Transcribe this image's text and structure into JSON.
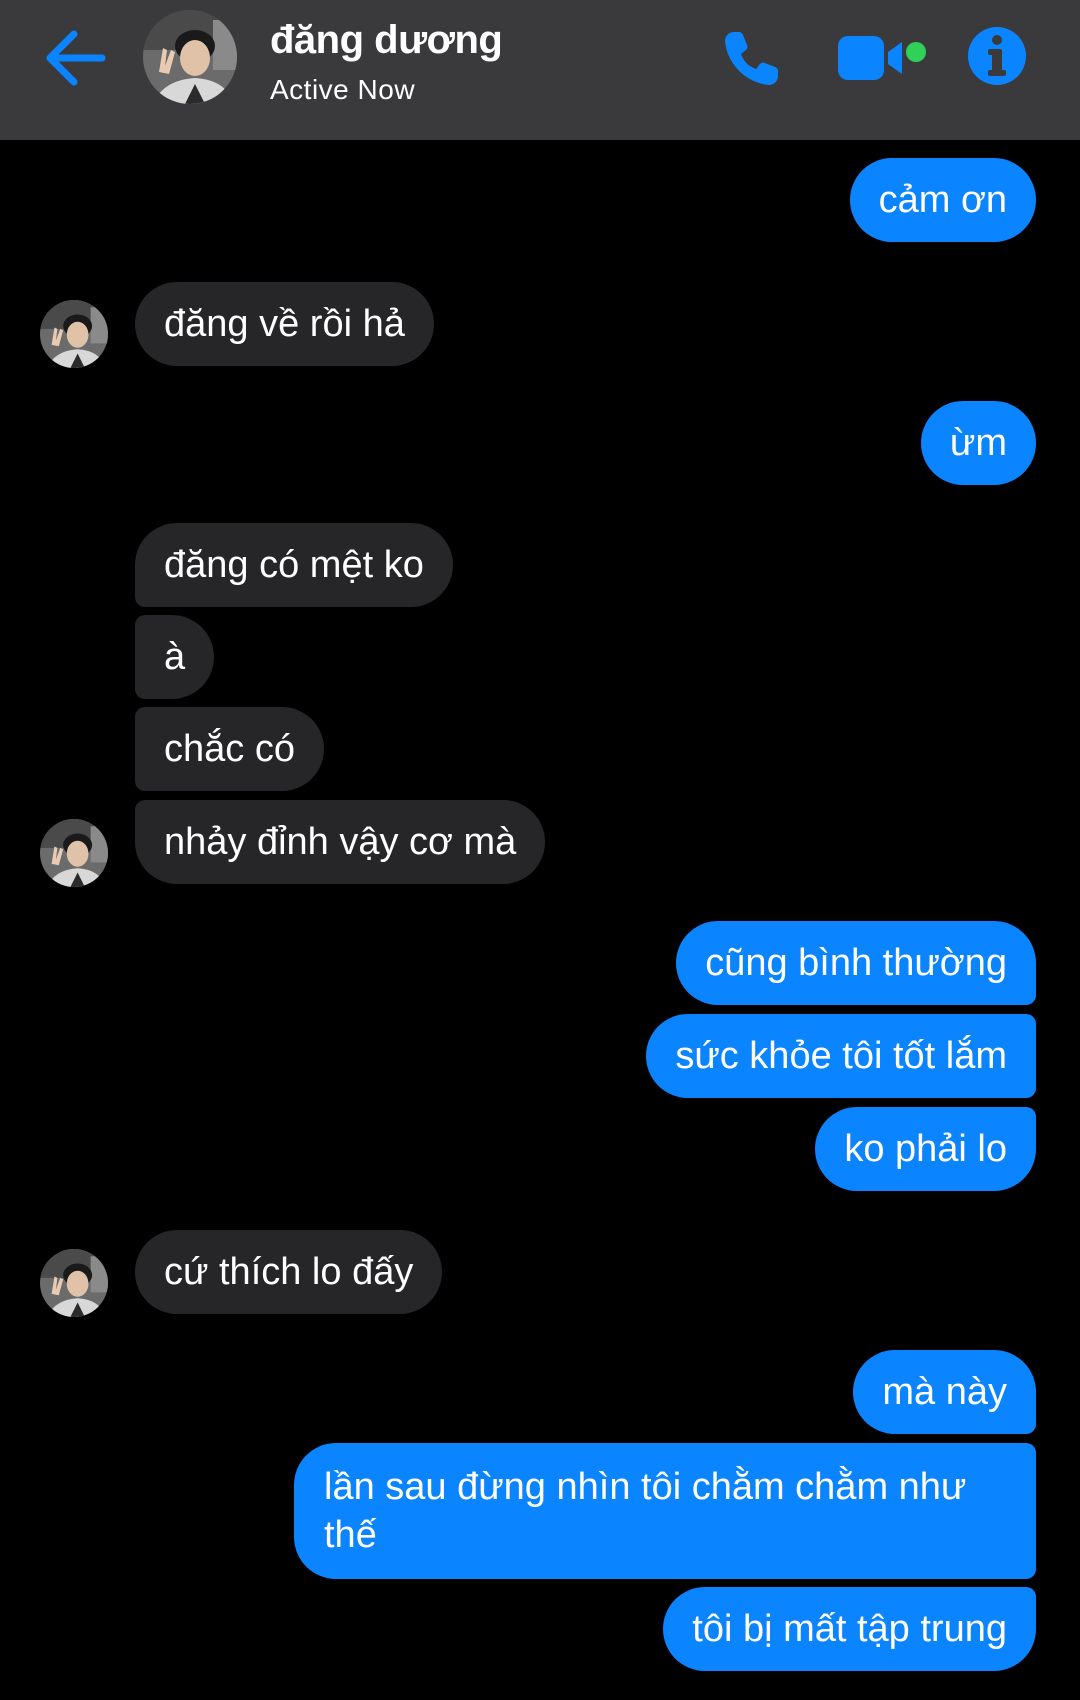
{
  "header": {
    "contact_name": "đăng dương",
    "status": "Active Now",
    "icons": {
      "back": "back-arrow-icon",
      "call": "phone-icon",
      "video": "video-camera-icon",
      "info": "info-icon"
    },
    "online_color": "#30d158"
  },
  "colors": {
    "accent": "#0a84ff",
    "header_bg": "#3a3a3c",
    "incoming_bubble": "#262628",
    "outgoing_bubble": "#0a84ff",
    "background": "#000000"
  },
  "messages": [
    {
      "direction": "outgoing",
      "text": "cảm ơn"
    },
    {
      "direction": "incoming",
      "text": "đăng về rồi hả",
      "avatar": true
    },
    {
      "direction": "outgoing",
      "text": "ừm"
    },
    {
      "direction": "incoming",
      "text": "đăng có mệt ko",
      "avatar": false
    },
    {
      "direction": "incoming",
      "text": "à",
      "avatar": false
    },
    {
      "direction": "incoming",
      "text": "chắc có",
      "avatar": false
    },
    {
      "direction": "incoming",
      "text": "nhảy đỉnh vậy cơ mà",
      "avatar": true
    },
    {
      "direction": "outgoing",
      "text": "cũng bình thường"
    },
    {
      "direction": "outgoing",
      "text": "sức khỏe tôi tốt lắm"
    },
    {
      "direction": "outgoing",
      "text": "ko phải lo"
    },
    {
      "direction": "incoming",
      "text": "cứ thích lo đấy",
      "avatar": true
    },
    {
      "direction": "outgoing",
      "text": "mà này"
    },
    {
      "direction": "outgoing",
      "text": "lần sau đừng nhìn tôi chằm chằm như thế"
    },
    {
      "direction": "outgoing",
      "text": "tôi bị mất tập trung"
    }
  ]
}
